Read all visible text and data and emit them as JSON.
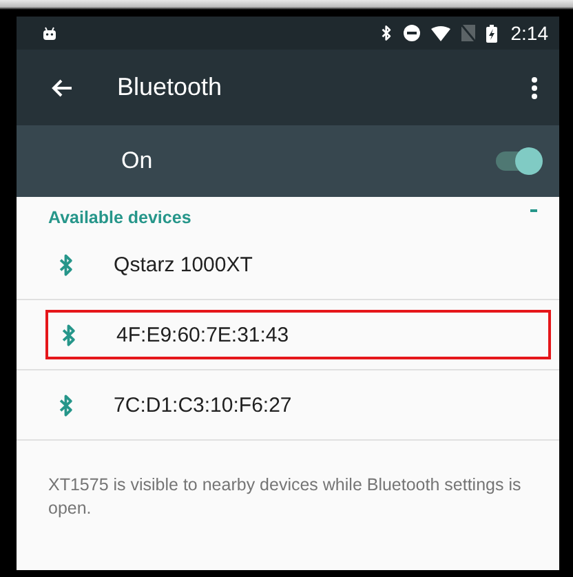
{
  "status_bar": {
    "time": "2:14"
  },
  "toolbar": {
    "title": "Bluetooth"
  },
  "master_switch": {
    "label": "On",
    "on": true
  },
  "section": {
    "title": "Available devices",
    "scanning": true
  },
  "devices": [
    {
      "name": "Qstarz 1000XT",
      "highlighted": false
    },
    {
      "name": "4F:E9:60:7E:31:43",
      "highlighted": true
    },
    {
      "name": "7C:D1:C3:10:F6:27",
      "highlighted": false
    }
  ],
  "footer": "XT1575 is visible to nearby devices while Bluetooth settings is open."
}
